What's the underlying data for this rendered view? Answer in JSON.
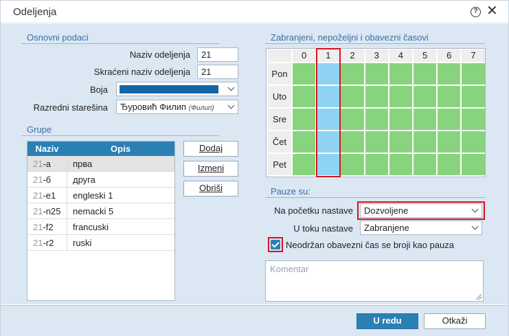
{
  "dialog": {
    "title": "Odeljenja",
    "help_icon": "?",
    "close_icon": "✕"
  },
  "osnovni": {
    "section_title": "Osnovni podaci",
    "naziv_label": "Naziv odeljenja",
    "naziv_value": "21",
    "skraceni_label": "Skraćeni naziv odeljenja",
    "skraceni_value": "21",
    "boja_label": "Boja",
    "boja_color": "#1565a5",
    "staresina_label": "Razredni starešina",
    "staresina_value": "Ђуровић Филип",
    "staresina_hint": "(Филип)"
  },
  "grupe": {
    "section_title": "Grupe",
    "columns": [
      "Naziv",
      "Opis"
    ],
    "rows": [
      {
        "prefix": "21",
        "suffix": "-a",
        "opis": "прва"
      },
      {
        "prefix": "21",
        "suffix": "-б",
        "opis": "друга"
      },
      {
        "prefix": "21",
        "suffix": "-e1",
        "opis": "engleski 1"
      },
      {
        "prefix": "21",
        "suffix": "-n25",
        "opis": "nemacki 5"
      },
      {
        "prefix": "21",
        "suffix": "-f2",
        "opis": "francuski"
      },
      {
        "prefix": "21",
        "suffix": "-r2",
        "opis": "ruski"
      }
    ],
    "buttons": {
      "dodaj": "Dodaj",
      "izmeni": "Izmeni",
      "obrisi": "Obriši"
    }
  },
  "casovi": {
    "section_title": "Zabranjeni, nepoželjni i obavezni časovi",
    "hours": [
      "0",
      "1",
      "2",
      "3",
      "4",
      "5",
      "6",
      "7"
    ],
    "days": [
      "Pon",
      "Uto",
      "Sre",
      "Čet",
      "Pet"
    ],
    "colors": {
      "allowed": "#88d47e",
      "selected": "#8fd3f2"
    },
    "selected_hour": "1"
  },
  "pauze": {
    "section_title": "Pauze su:",
    "na_pocetku_label": "Na početku nastave",
    "na_pocetku_value": "Dozvoljene",
    "u_toku_label": "U toku nastave",
    "u_toku_value": "Zabranjene",
    "checkbox_label": "Neodržan obavezni čas se broji kao pauza",
    "checkbox_checked": true,
    "komentar_placeholder": "Komentar"
  },
  "footer": {
    "ok_label": "U redu",
    "cancel_label": "Otkaži"
  }
}
